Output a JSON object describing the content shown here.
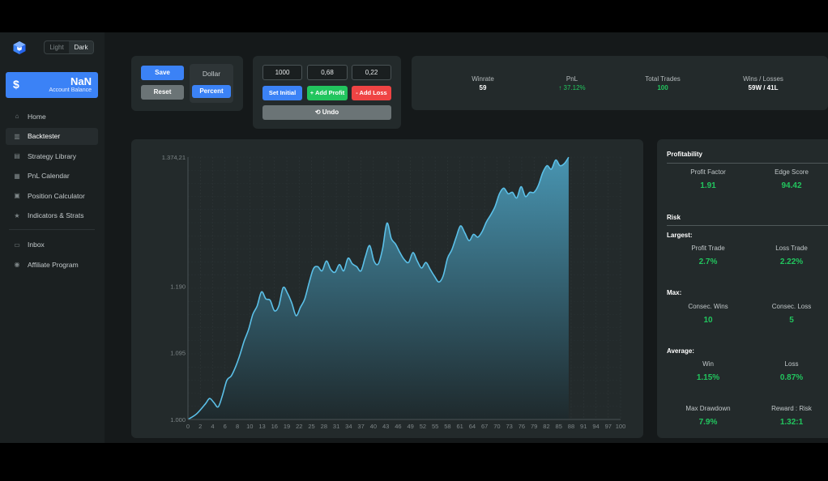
{
  "theme": {
    "light": "Light",
    "dark": "Dark"
  },
  "balance": {
    "symbol": "$",
    "amount": "NaN",
    "label": "Account Balance"
  },
  "nav": [
    {
      "icon": "home-icon",
      "glyph": "⌂",
      "label": "Home"
    },
    {
      "icon": "bar-chart-icon",
      "glyph": "▥",
      "label": "Backtester",
      "active": true
    },
    {
      "icon": "library-icon",
      "glyph": "▤",
      "label": "Strategy Library"
    },
    {
      "icon": "calendar-icon",
      "glyph": "▦",
      "label": "PnL Calendar"
    },
    {
      "icon": "calculator-icon",
      "glyph": "▣",
      "label": "Position Calculator"
    },
    {
      "icon": "star-icon",
      "glyph": "★",
      "label": "Indicators & Strats"
    }
  ],
  "nav2": [
    {
      "icon": "inbox-icon",
      "glyph": "▭",
      "label": "Inbox"
    },
    {
      "icon": "user-icon",
      "glyph": "◉",
      "label": "Affiliate Program"
    }
  ],
  "controls": {
    "save": "Save",
    "reset": "Reset",
    "dollar": "Dollar",
    "percent": "Percent",
    "initial_value": "1000",
    "profit_value": "0,68",
    "loss_value": "0,22",
    "set_initial": "Set Initial",
    "add_profit": "+ Add Profit",
    "add_loss": "- Add Loss",
    "undo": "⟲ Undo"
  },
  "stats": {
    "winrate_label": "Winrate",
    "winrate": "59",
    "pnl_label": "PnL",
    "pnl": "↑ 37.12%",
    "total_label": "Total Trades",
    "total": "100",
    "wl_label": "Wins / Losses",
    "wl": "59W / 41L"
  },
  "panel": {
    "profitability": "Profitability",
    "profit_factor_label": "Profit Factor",
    "profit_factor": "1.91",
    "edge_label": "Edge Score",
    "edge": "94.42",
    "risk": "Risk",
    "largest": "Largest:",
    "profit_trade_label": "Profit Trade",
    "profit_trade": "2.7%",
    "loss_trade_label": "Loss Trade",
    "loss_trade": "2.22%",
    "max": "Max:",
    "consec_wins_label": "Consec. Wins",
    "consec_wins": "10",
    "consec_loss_label": "Consec. Loss",
    "consec_loss": "5",
    "average": "Average:",
    "win_label": "Win",
    "win": "1.15%",
    "loss_label": "Loss",
    "loss": "0.87%",
    "drawdown_label": "Max Drawdown",
    "drawdown": "7.9%",
    "rr_label": "Reward : Risk",
    "rr": "1.32:1"
  },
  "colors": {
    "accent": "#3b82f6",
    "profit": "#22c55e",
    "loss": "#ef4444",
    "line": "#5bc0e8"
  },
  "chart_data": {
    "type": "area",
    "y_tick_labels": [
      "1.000",
      "1.095",
      "1.190",
      "1.374,21"
    ],
    "y_ticks": [
      1000,
      1095,
      1190,
      1374.21
    ],
    "ylim": [
      1000,
      1374.21
    ],
    "x_tick_labels": [
      "0",
      "2",
      "4",
      "6",
      "8",
      "10",
      "13",
      "16",
      "19",
      "22",
      "25",
      "28",
      "31",
      "34",
      "37",
      "40",
      "43",
      "46",
      "49",
      "52",
      "55",
      "58",
      "61",
      "64",
      "67",
      "70",
      "73",
      "76",
      "79",
      "82",
      "85",
      "88",
      "91",
      "94",
      "97",
      "100"
    ],
    "xlim": [
      0,
      100
    ],
    "grid": true,
    "points": [
      [
        0,
        1000
      ],
      [
        2,
        1008
      ],
      [
        4,
        1022
      ],
      [
        5,
        1030
      ],
      [
        6,
        1024
      ],
      [
        7,
        1018
      ],
      [
        8,
        1035
      ],
      [
        9,
        1056
      ],
      [
        10,
        1062
      ],
      [
        11,
        1075
      ],
      [
        12,
        1092
      ],
      [
        13,
        1112
      ],
      [
        14,
        1128
      ],
      [
        15,
        1150
      ],
      [
        16,
        1162
      ],
      [
        17,
        1182
      ],
      [
        18,
        1172
      ],
      [
        19,
        1170
      ],
      [
        20,
        1155
      ],
      [
        21,
        1162
      ],
      [
        22,
        1188
      ],
      [
        23,
        1180
      ],
      [
        24,
        1166
      ],
      [
        25,
        1148
      ],
      [
        26,
        1160
      ],
      [
        27,
        1172
      ],
      [
        28,
        1195
      ],
      [
        29,
        1215
      ],
      [
        30,
        1218
      ],
      [
        31,
        1212
      ],
      [
        32,
        1226
      ],
      [
        33,
        1214
      ],
      [
        34,
        1210
      ],
      [
        35,
        1221
      ],
      [
        36,
        1212
      ],
      [
        37,
        1230
      ],
      [
        38,
        1222
      ],
      [
        39,
        1218
      ],
      [
        40,
        1212
      ],
      [
        41,
        1232
      ],
      [
        42,
        1248
      ],
      [
        43,
        1226
      ],
      [
        44,
        1222
      ],
      [
        45,
        1244
      ],
      [
        46,
        1280
      ],
      [
        47,
        1258
      ],
      [
        48,
        1250
      ],
      [
        49,
        1238
      ],
      [
        50,
        1228
      ],
      [
        51,
        1224
      ],
      [
        52,
        1238
      ],
      [
        53,
        1226
      ],
      [
        54,
        1216
      ],
      [
        55,
        1224
      ],
      [
        56,
        1214
      ],
      [
        57,
        1204
      ],
      [
        58,
        1196
      ],
      [
        59,
        1205
      ],
      [
        60,
        1230
      ],
      [
        61,
        1242
      ],
      [
        62,
        1260
      ],
      [
        63,
        1276
      ],
      [
        64,
        1266
      ],
      [
        65,
        1255
      ],
      [
        66,
        1264
      ],
      [
        67,
        1260
      ],
      [
        68,
        1268
      ],
      [
        69,
        1282
      ],
      [
        70,
        1292
      ],
      [
        71,
        1304
      ],
      [
        72,
        1322
      ],
      [
        73,
        1330
      ],
      [
        74,
        1322
      ],
      [
        75,
        1324
      ],
      [
        76,
        1316
      ],
      [
        77,
        1332
      ],
      [
        78,
        1318
      ],
      [
        79,
        1324
      ],
      [
        80,
        1324
      ],
      [
        81,
        1334
      ],
      [
        82,
        1352
      ],
      [
        83,
        1362
      ],
      [
        84,
        1357
      ],
      [
        85,
        1370
      ],
      [
        86,
        1362
      ],
      [
        87,
        1365
      ],
      [
        88,
        1374
      ]
    ]
  }
}
